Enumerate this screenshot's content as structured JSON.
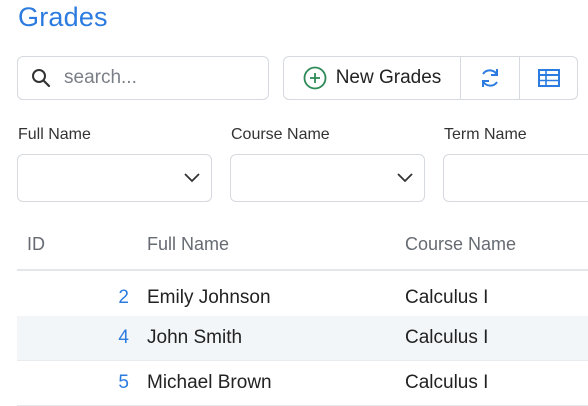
{
  "page": {
    "title": "Grades"
  },
  "search": {
    "placeholder": "search..."
  },
  "toolbar": {
    "new_label": "New Grades",
    "icons": [
      "plus-circle-icon",
      "refresh-icon",
      "table-icon"
    ]
  },
  "filters": [
    {
      "label": "Full Name",
      "value": ""
    },
    {
      "label": "Course Name",
      "value": ""
    },
    {
      "label": "Term Name",
      "value": ""
    }
  ],
  "table": {
    "columns": [
      "ID",
      "Full Name",
      "Course Name"
    ],
    "rows": [
      {
        "id": "2",
        "full_name": "Emily Johnson",
        "course_name": "Calculus I"
      },
      {
        "id": "4",
        "full_name": "John Smith",
        "course_name": "Calculus I"
      },
      {
        "id": "5",
        "full_name": "Michael Brown",
        "course_name": "Calculus I"
      }
    ]
  },
  "colors": {
    "accent": "#2b7be0",
    "success": "#2e8b57",
    "row_alt": "#f3f6f9",
    "border": "#d6d9de"
  }
}
